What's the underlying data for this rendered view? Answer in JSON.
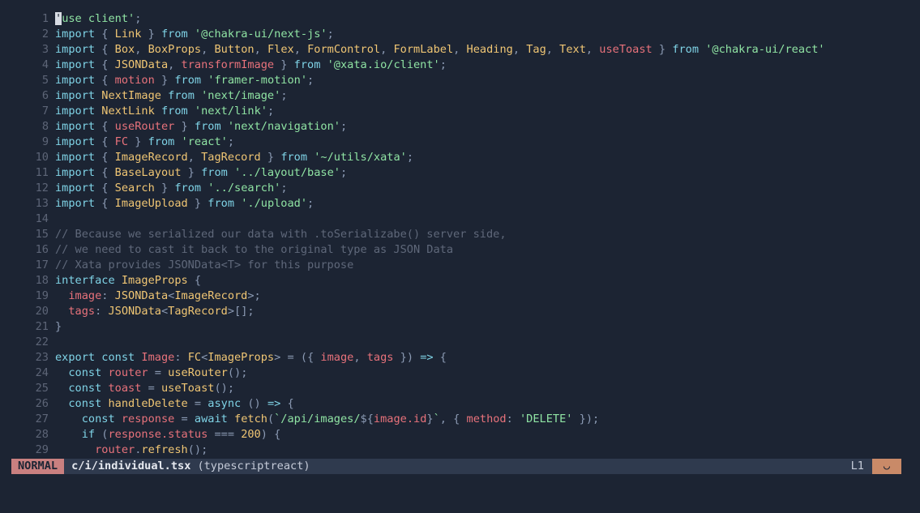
{
  "editor": {
    "lines": [
      {
        "n": "1",
        "tokens": [
          {
            "c": "cursor",
            "t": "'"
          },
          {
            "c": "t-str",
            "t": "use client'"
          },
          {
            "c": "t-pn",
            "t": ";"
          }
        ]
      },
      {
        "n": "2",
        "tokens": [
          {
            "c": "t-kw",
            "t": "import"
          },
          {
            "c": "t-pn",
            "t": " { "
          },
          {
            "c": "t-id",
            "t": "Link"
          },
          {
            "c": "t-pn",
            "t": " } "
          },
          {
            "c": "t-kw",
            "t": "from"
          },
          {
            "c": "t-pl",
            "t": " "
          },
          {
            "c": "t-str",
            "t": "'@chakra-ui/next-js'"
          },
          {
            "c": "t-pn",
            "t": ";"
          }
        ]
      },
      {
        "n": "3",
        "tokens": [
          {
            "c": "t-kw",
            "t": "import"
          },
          {
            "c": "t-pn",
            "t": " { "
          },
          {
            "c": "t-id",
            "t": "Box"
          },
          {
            "c": "t-pn",
            "t": ", "
          },
          {
            "c": "t-id",
            "t": "BoxProps"
          },
          {
            "c": "t-pn",
            "t": ", "
          },
          {
            "c": "t-id",
            "t": "Button"
          },
          {
            "c": "t-pn",
            "t": ", "
          },
          {
            "c": "t-id",
            "t": "Flex"
          },
          {
            "c": "t-pn",
            "t": ", "
          },
          {
            "c": "t-id",
            "t": "FormControl"
          },
          {
            "c": "t-pn",
            "t": ", "
          },
          {
            "c": "t-id",
            "t": "FormLabel"
          },
          {
            "c": "t-pn",
            "t": ", "
          },
          {
            "c": "t-id",
            "t": "Heading"
          },
          {
            "c": "t-pn",
            "t": ", "
          },
          {
            "c": "t-id",
            "t": "Tag"
          },
          {
            "c": "t-pn",
            "t": ", "
          },
          {
            "c": "t-id",
            "t": "Text"
          },
          {
            "c": "t-pn",
            "t": ", "
          },
          {
            "c": "t-red",
            "t": "useToast"
          },
          {
            "c": "t-pn",
            "t": " } "
          },
          {
            "c": "t-kw",
            "t": "from"
          },
          {
            "c": "t-pl",
            "t": " "
          },
          {
            "c": "t-str",
            "t": "'@chakra-ui/react'"
          }
        ]
      },
      {
        "n": "4",
        "tokens": [
          {
            "c": "t-kw",
            "t": "import"
          },
          {
            "c": "t-pn",
            "t": " { "
          },
          {
            "c": "t-id",
            "t": "JSONData"
          },
          {
            "c": "t-pn",
            "t": ", "
          },
          {
            "c": "t-red",
            "t": "transformImage"
          },
          {
            "c": "t-pn",
            "t": " } "
          },
          {
            "c": "t-kw",
            "t": "from"
          },
          {
            "c": "t-pl",
            "t": " "
          },
          {
            "c": "t-str",
            "t": "'@xata.io/client'"
          },
          {
            "c": "t-pn",
            "t": ";"
          }
        ]
      },
      {
        "n": "5",
        "tokens": [
          {
            "c": "t-kw",
            "t": "import"
          },
          {
            "c": "t-pn",
            "t": " { "
          },
          {
            "c": "t-red",
            "t": "motion"
          },
          {
            "c": "t-pn",
            "t": " } "
          },
          {
            "c": "t-kw",
            "t": "from"
          },
          {
            "c": "t-pl",
            "t": " "
          },
          {
            "c": "t-str",
            "t": "'framer-motion'"
          },
          {
            "c": "t-pn",
            "t": ";"
          }
        ]
      },
      {
        "n": "6",
        "tokens": [
          {
            "c": "t-kw",
            "t": "import"
          },
          {
            "c": "t-pl",
            "t": " "
          },
          {
            "c": "t-id",
            "t": "NextImage"
          },
          {
            "c": "t-pl",
            "t": " "
          },
          {
            "c": "t-kw",
            "t": "from"
          },
          {
            "c": "t-pl",
            "t": " "
          },
          {
            "c": "t-str",
            "t": "'next/image'"
          },
          {
            "c": "t-pn",
            "t": ";"
          }
        ]
      },
      {
        "n": "7",
        "tokens": [
          {
            "c": "t-kw",
            "t": "import"
          },
          {
            "c": "t-pl",
            "t": " "
          },
          {
            "c": "t-id",
            "t": "NextLink"
          },
          {
            "c": "t-pl",
            "t": " "
          },
          {
            "c": "t-kw",
            "t": "from"
          },
          {
            "c": "t-pl",
            "t": " "
          },
          {
            "c": "t-str",
            "t": "'next/link'"
          },
          {
            "c": "t-pn",
            "t": ";"
          }
        ]
      },
      {
        "n": "8",
        "tokens": [
          {
            "c": "t-kw",
            "t": "import"
          },
          {
            "c": "t-pn",
            "t": " { "
          },
          {
            "c": "t-red",
            "t": "useRouter"
          },
          {
            "c": "t-pn",
            "t": " } "
          },
          {
            "c": "t-kw",
            "t": "from"
          },
          {
            "c": "t-pl",
            "t": " "
          },
          {
            "c": "t-str",
            "t": "'next/navigation'"
          },
          {
            "c": "t-pn",
            "t": ";"
          }
        ]
      },
      {
        "n": "9",
        "tokens": [
          {
            "c": "t-kw",
            "t": "import"
          },
          {
            "c": "t-pn",
            "t": " { "
          },
          {
            "c": "t-red",
            "t": "FC"
          },
          {
            "c": "t-pn",
            "t": " } "
          },
          {
            "c": "t-kw",
            "t": "from"
          },
          {
            "c": "t-pl",
            "t": " "
          },
          {
            "c": "t-str",
            "t": "'react'"
          },
          {
            "c": "t-pn",
            "t": ";"
          }
        ]
      },
      {
        "n": "10",
        "tokens": [
          {
            "c": "t-kw",
            "t": "import"
          },
          {
            "c": "t-pn",
            "t": " { "
          },
          {
            "c": "t-id",
            "t": "ImageRecord"
          },
          {
            "c": "t-pn",
            "t": ", "
          },
          {
            "c": "t-id",
            "t": "TagRecord"
          },
          {
            "c": "t-pn",
            "t": " } "
          },
          {
            "c": "t-kw",
            "t": "from"
          },
          {
            "c": "t-pl",
            "t": " "
          },
          {
            "c": "t-str",
            "t": "'~/utils/xata'"
          },
          {
            "c": "t-pn",
            "t": ";"
          }
        ]
      },
      {
        "n": "11",
        "tokens": [
          {
            "c": "t-kw",
            "t": "import"
          },
          {
            "c": "t-pn",
            "t": " { "
          },
          {
            "c": "t-id",
            "t": "BaseLayout"
          },
          {
            "c": "t-pn",
            "t": " } "
          },
          {
            "c": "t-kw",
            "t": "from"
          },
          {
            "c": "t-pl",
            "t": " "
          },
          {
            "c": "t-str",
            "t": "'../layout/base'"
          },
          {
            "c": "t-pn",
            "t": ";"
          }
        ]
      },
      {
        "n": "12",
        "tokens": [
          {
            "c": "t-kw",
            "t": "import"
          },
          {
            "c": "t-pn",
            "t": " { "
          },
          {
            "c": "t-id",
            "t": "Search"
          },
          {
            "c": "t-pn",
            "t": " } "
          },
          {
            "c": "t-kw",
            "t": "from"
          },
          {
            "c": "t-pl",
            "t": " "
          },
          {
            "c": "t-str",
            "t": "'../search'"
          },
          {
            "c": "t-pn",
            "t": ";"
          }
        ]
      },
      {
        "n": "13",
        "tokens": [
          {
            "c": "t-kw",
            "t": "import"
          },
          {
            "c": "t-pn",
            "t": " { "
          },
          {
            "c": "t-id",
            "t": "ImageUpload"
          },
          {
            "c": "t-pn",
            "t": " } "
          },
          {
            "c": "t-kw",
            "t": "from"
          },
          {
            "c": "t-pl",
            "t": " "
          },
          {
            "c": "t-str",
            "t": "'./upload'"
          },
          {
            "c": "t-pn",
            "t": ";"
          }
        ]
      },
      {
        "n": "14",
        "tokens": []
      },
      {
        "n": "15",
        "tokens": [
          {
            "c": "t-cm",
            "t": "// Because we serialized our data with .toSerializabe() server side,"
          }
        ]
      },
      {
        "n": "16",
        "tokens": [
          {
            "c": "t-cm",
            "t": "// we need to cast it back to the original type as JSON Data"
          }
        ]
      },
      {
        "n": "17",
        "tokens": [
          {
            "c": "t-cm",
            "t": "// Xata provides JSONData<T> for this purpose"
          }
        ]
      },
      {
        "n": "18",
        "tokens": [
          {
            "c": "t-kw",
            "t": "interface"
          },
          {
            "c": "t-pl",
            "t": " "
          },
          {
            "c": "t-ty",
            "t": "ImageProps"
          },
          {
            "c": "t-pn",
            "t": " {"
          }
        ]
      },
      {
        "n": "19",
        "tokens": [
          {
            "c": "t-pl",
            "t": "  "
          },
          {
            "c": "t-red",
            "t": "image"
          },
          {
            "c": "t-pn",
            "t": ": "
          },
          {
            "c": "t-ty",
            "t": "JSONData"
          },
          {
            "c": "t-pn",
            "t": "<"
          },
          {
            "c": "t-ty",
            "t": "ImageRecord"
          },
          {
            "c": "t-pn",
            "t": ">;"
          }
        ]
      },
      {
        "n": "20",
        "tokens": [
          {
            "c": "t-pl",
            "t": "  "
          },
          {
            "c": "t-red",
            "t": "tags"
          },
          {
            "c": "t-pn",
            "t": ": "
          },
          {
            "c": "t-ty",
            "t": "JSONData"
          },
          {
            "c": "t-pn",
            "t": "<"
          },
          {
            "c": "t-ty",
            "t": "TagRecord"
          },
          {
            "c": "t-pn",
            "t": ">[];"
          }
        ]
      },
      {
        "n": "21",
        "tokens": [
          {
            "c": "t-pn",
            "t": "}"
          }
        ]
      },
      {
        "n": "22",
        "tokens": []
      },
      {
        "n": "23",
        "tokens": [
          {
            "c": "t-kw",
            "t": "export"
          },
          {
            "c": "t-pl",
            "t": " "
          },
          {
            "c": "t-kw",
            "t": "const"
          },
          {
            "c": "t-pl",
            "t": " "
          },
          {
            "c": "t-red",
            "t": "Image"
          },
          {
            "c": "t-pn",
            "t": ": "
          },
          {
            "c": "t-ty",
            "t": "FC"
          },
          {
            "c": "t-pn",
            "t": "<"
          },
          {
            "c": "t-ty",
            "t": "ImageProps"
          },
          {
            "c": "t-pn",
            "t": "> = ({ "
          },
          {
            "c": "t-red",
            "t": "image"
          },
          {
            "c": "t-pn",
            "t": ", "
          },
          {
            "c": "t-red",
            "t": "tags"
          },
          {
            "c": "t-pn",
            "t": " }) "
          },
          {
            "c": "t-kw",
            "t": "=>"
          },
          {
            "c": "t-pn",
            "t": " {"
          }
        ]
      },
      {
        "n": "24",
        "tokens": [
          {
            "c": "t-pl",
            "t": "  "
          },
          {
            "c": "t-kw",
            "t": "const"
          },
          {
            "c": "t-pl",
            "t": " "
          },
          {
            "c": "t-red",
            "t": "router"
          },
          {
            "c": "t-pn",
            "t": " = "
          },
          {
            "c": "t-fn",
            "t": "useRouter"
          },
          {
            "c": "t-pn",
            "t": "();"
          }
        ]
      },
      {
        "n": "25",
        "tokens": [
          {
            "c": "t-pl",
            "t": "  "
          },
          {
            "c": "t-kw",
            "t": "const"
          },
          {
            "c": "t-pl",
            "t": " "
          },
          {
            "c": "t-red",
            "t": "toast"
          },
          {
            "c": "t-pn",
            "t": " = "
          },
          {
            "c": "t-fn",
            "t": "useToast"
          },
          {
            "c": "t-pn",
            "t": "();"
          }
        ]
      },
      {
        "n": "26",
        "tokens": [
          {
            "c": "t-pl",
            "t": "  "
          },
          {
            "c": "t-kw",
            "t": "const"
          },
          {
            "c": "t-pl",
            "t": " "
          },
          {
            "c": "t-fn",
            "t": "handleDelete"
          },
          {
            "c": "t-pn",
            "t": " = "
          },
          {
            "c": "t-kw",
            "t": "async"
          },
          {
            "c": "t-pn",
            "t": " () "
          },
          {
            "c": "t-kw",
            "t": "=>"
          },
          {
            "c": "t-pn",
            "t": " {"
          }
        ]
      },
      {
        "n": "27",
        "tokens": [
          {
            "c": "t-pl",
            "t": "    "
          },
          {
            "c": "t-kw",
            "t": "const"
          },
          {
            "c": "t-pl",
            "t": " "
          },
          {
            "c": "t-red",
            "t": "response"
          },
          {
            "c": "t-pn",
            "t": " = "
          },
          {
            "c": "t-kw",
            "t": "await"
          },
          {
            "c": "t-pl",
            "t": " "
          },
          {
            "c": "t-fn",
            "t": "fetch"
          },
          {
            "c": "t-pn",
            "t": "("
          },
          {
            "c": "t-str",
            "t": "`/api/images/"
          },
          {
            "c": "t-pn",
            "t": "${"
          },
          {
            "c": "t-red",
            "t": "image.id"
          },
          {
            "c": "t-pn",
            "t": "}"
          },
          {
            "c": "t-str",
            "t": "`"
          },
          {
            "c": "t-pn",
            "t": ", { "
          },
          {
            "c": "t-red",
            "t": "method"
          },
          {
            "c": "t-pn",
            "t": ": "
          },
          {
            "c": "t-str",
            "t": "'DELETE'"
          },
          {
            "c": "t-pn",
            "t": " });"
          }
        ]
      },
      {
        "n": "28",
        "tokens": [
          {
            "c": "t-pl",
            "t": "    "
          },
          {
            "c": "t-kw",
            "t": "if"
          },
          {
            "c": "t-pn",
            "t": " ("
          },
          {
            "c": "t-red",
            "t": "response.status"
          },
          {
            "c": "t-pn",
            "t": " === "
          },
          {
            "c": "t-nm",
            "t": "200"
          },
          {
            "c": "t-pn",
            "t": ") {"
          }
        ]
      },
      {
        "n": "29",
        "tokens": [
          {
            "c": "t-pl",
            "t": "      "
          },
          {
            "c": "t-red",
            "t": "router"
          },
          {
            "c": "t-pn",
            "t": "."
          },
          {
            "c": "t-fn",
            "t": "refresh"
          },
          {
            "c": "t-pn",
            "t": "();"
          }
        ]
      }
    ]
  },
  "statusline": {
    "mode": "NORMAL",
    "filename": "c/i/individual.tsx",
    "filetype": "(typescriptreact)",
    "position": "L1",
    "face_icon": "◡",
    "face_icon_name": "smile-icon"
  },
  "colors": {
    "background": "#1c2433",
    "mode_bg": "#c98080",
    "face_bg": "#c98a68",
    "statusline_bg": "#2f3a4e"
  }
}
